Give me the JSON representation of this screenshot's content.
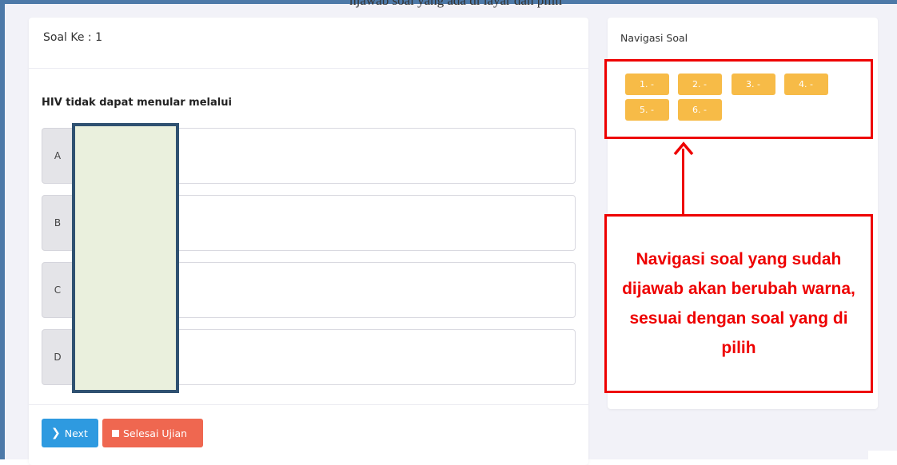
{
  "caption_fragment": "njawab soal yang ada di layar dan pilih",
  "question_card": {
    "header": "Soal Ke : 1",
    "question": "HIV tidak dapat menular melalui",
    "options": [
      {
        "letter": "A",
        "text": ""
      },
      {
        "letter": "B",
        "text": ""
      },
      {
        "letter": "C",
        "text": ""
      },
      {
        "letter": "D",
        "text": ""
      }
    ],
    "next_label": "Next",
    "finish_label": "Selesai Ujian"
  },
  "navigation": {
    "title": "Navigasi Soal",
    "items": [
      "1. -",
      "2. -",
      "3. -",
      "4. -",
      "5. -",
      "6. -"
    ]
  },
  "annotation": {
    "text": "Navigasi soal yang sudah dijawab akan berubah warna, sesuai dengan soal yang di pilih"
  },
  "colors": {
    "primary": "#2e9ae0",
    "danger": "#ef6750",
    "nav_unanswered": "#f7bb47",
    "annotation": "#ee0000"
  },
  "icons": {
    "next": "chevron-right-icon",
    "finish": "square-icon"
  }
}
